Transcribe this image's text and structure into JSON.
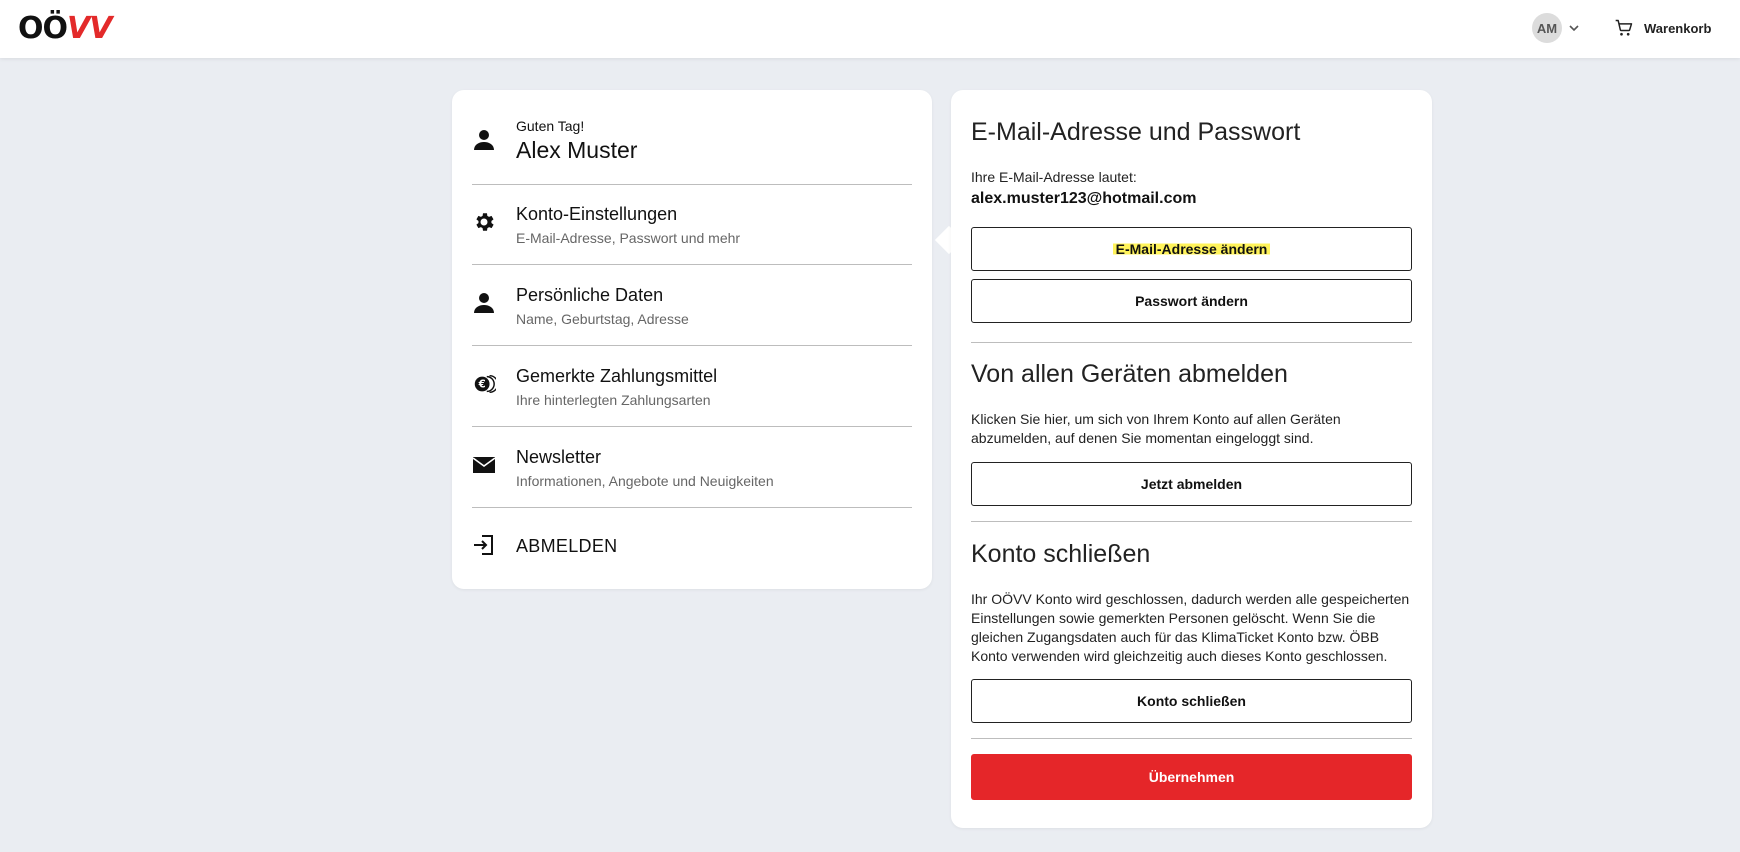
{
  "header": {
    "logo_dark": "OÖ",
    "logo_red": "VV",
    "avatar_initials": "AM",
    "cart_label": "Warenkorb"
  },
  "sidebar": {
    "greeting": "Guten Tag!",
    "user_name": "Alex Muster",
    "items": [
      {
        "title": "Konto-Einstellungen",
        "subtitle": "E-Mail-Adresse, Passwort und mehr"
      },
      {
        "title": "Persönliche Daten",
        "subtitle": "Name, Geburtstag, Adresse"
      },
      {
        "title": "Gemerkte Zahlungsmittel",
        "subtitle": "Ihre hinterlegten Zahlungsarten"
      },
      {
        "title": "Newsletter",
        "subtitle": "Informationen, Angebote und Neuigkeiten"
      }
    ],
    "logout_label": "ABMELDEN"
  },
  "account": {
    "email_section_title": "E-Mail-Adresse und Passwort",
    "email_intro": "Ihre E-Mail-Adresse lautet:",
    "email_value": "alex.muster123@hotmail.com",
    "change_email_label": "E-Mail-Adresse ändern",
    "change_password_label": "Passwort ändern",
    "logout_all_title": "Von allen Geräten abmelden",
    "logout_all_text": "Klicken Sie hier, um sich von Ihrem Konto auf allen Geräten abzumelden, auf denen Sie momentan eingeloggt sind.",
    "logout_all_button": "Jetzt abmelden",
    "close_title": "Konto schließen",
    "close_text": "Ihr OÖVV Konto wird geschlossen, dadurch werden alle gespeicherten Einstellungen sowie gemerkten Personen gelöscht. Wenn Sie die gleichen Zugangsdaten auch für das KlimaTicket Konto bzw. ÖBB Konto verwenden wird gleichzeitig auch dieses Konto geschlossen.",
    "close_button": "Konto schließen",
    "apply_button": "Übernehmen"
  },
  "colors": {
    "brand_red": "#e52629",
    "highlight": "#fff35a",
    "background": "#eaedf2"
  }
}
